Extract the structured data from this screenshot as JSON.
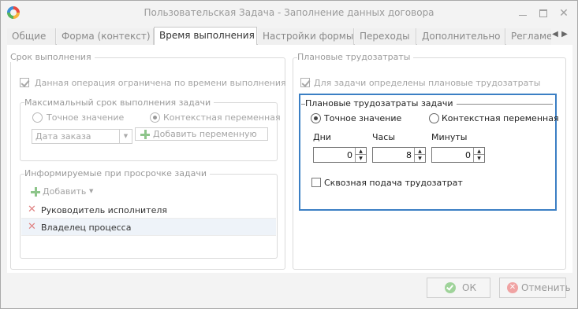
{
  "window": {
    "title": "Пользовательская Задача - Заполнение данных договора",
    "close_glyph": "✕"
  },
  "tabs": [
    {
      "label": "Общие"
    },
    {
      "label": "Форма (контекст)"
    },
    {
      "label": "Время выполнения"
    },
    {
      "label": "Настройки формы"
    },
    {
      "label": "Переходы"
    },
    {
      "label": "Дополнительно"
    },
    {
      "label": "Регламе"
    }
  ],
  "tab_arrows": {
    "left": "◀",
    "right": "▶"
  },
  "deadline": {
    "title": "Срок выполнения",
    "limited_checkbox_label": "Данная операция ограничена по времени выполнения",
    "max_group_title": "Максимальный срок выполнения задачи",
    "exact_label": "Точное значение",
    "context_label": "Контекстная переменная",
    "combo_value": "Дата заказа",
    "combo_arrow": "▼",
    "add_variable_label": "Добавить переменную"
  },
  "informed": {
    "title": "Информируемые при просрочке задачи",
    "add_label": "Добавить",
    "add_arrow": "▼",
    "items": [
      {
        "label": "Руководитель исполнителя"
      },
      {
        "label": "Владелец процесса"
      }
    ],
    "remove_glyph": "✕"
  },
  "planned": {
    "title": "Плановые трудозатраты",
    "checkbox_label": "Для задачи определены плановые трудозатраты",
    "group_title": "Плановые трудозатраты задачи",
    "exact_label": "Точное значение",
    "context_label": "Контекстная переменная",
    "days_label": "Дни",
    "hours_label": "Часы",
    "minutes_label": "Минуты",
    "days_value": "0",
    "hours_value": "8",
    "minutes_value": "0",
    "spin_up": "▲",
    "spin_down": "▼",
    "through_label": "Сквозная подача трудозатрат"
  },
  "footer": {
    "ok_label": "ОК",
    "cancel_label": "Отменить",
    "cancel_glyph": "✕"
  },
  "colors": {
    "highlight_border": "#3b7fc4",
    "disabled_text": "#a5a5a5"
  }
}
